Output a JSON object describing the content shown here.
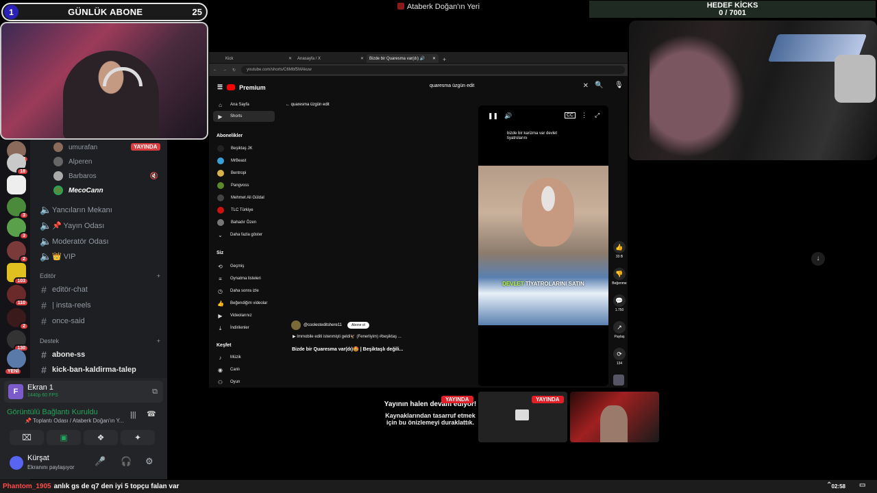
{
  "overlay": {
    "abone_num": "1",
    "abone_title": "GÜNLÜK ABONE",
    "abone_count": "25",
    "stream_title": "Ataberk Doğan'ın Yeri",
    "kicks_title": "HEDEF KİCKS",
    "kicks_value": "0 / 7001"
  },
  "discord": {
    "servers": [
      {
        "badge": "10"
      },
      {
        "badge": "18"
      },
      {
        "badge": ""
      },
      {
        "badge": "3"
      },
      {
        "badge": "3"
      },
      {
        "badge": "2"
      },
      {
        "badge": "103"
      },
      {
        "badge": "110"
      },
      {
        "badge": "2"
      },
      {
        "badge": "130"
      },
      {
        "badge": "YENİ"
      }
    ],
    "live_badge": "YAYINDA",
    "users": [
      "umurafan",
      "Alperen",
      "Barbaros",
      "MecoCann"
    ],
    "channels": [
      "Yancıların Mekanı",
      "📌 Yayın Odası",
      "Moderatör Odası",
      "👑 VIP"
    ],
    "cat_editor": "Editör",
    "editor_channels": [
      "editör-chat",
      "| insta-reels",
      "once-said"
    ],
    "cat_destek": "Destek",
    "destek_channels": [
      "abone-ss",
      "kick-ban-kaldirma-talep"
    ],
    "screen_title": "Ekran 1",
    "screen_sub": "1440p 60 FPS",
    "voice_status": "Görüntülü Bağlantı Kuruldu",
    "voice_channel": "📌 Toplantı Odası / Ataberk Doğan'ın Y...",
    "user_name": "Kürşat",
    "user_status": "Ekranını paylaşıyor"
  },
  "browser": {
    "tabs": [
      "Kick",
      "Anasayfa / X",
      "Bizde bir Quaresma var(dı) 🔊"
    ],
    "url": "youtube.com/shorts/C6Mbf5MAkuw",
    "logo": "Premium",
    "search_value": "quaresma üzgün edit",
    "nav": [
      {
        "label": "Ana Sayfa",
        "icon": "⌂"
      },
      {
        "label": "Shorts",
        "icon": "▶"
      }
    ],
    "subs_title": "Abonelikler",
    "subs": [
      {
        "label": "Beşiktaş JK",
        "color": "#222"
      },
      {
        "label": "MrBeast",
        "color": "#3aa0d8"
      },
      {
        "label": "Bentropi",
        "color": "#d8b34a"
      },
      {
        "label": "Pangvoss",
        "color": "#5a8a2a"
      },
      {
        "label": "Mehmet Ali Güldal",
        "color": "#444"
      },
      {
        "label": "TLC Türkiye",
        "color": "#c11"
      },
      {
        "label": "Bahadır Özen",
        "color": "#777"
      },
      {
        "label": "Daha fazla göster",
        "color": ""
      }
    ],
    "you_title": "Siz",
    "you": [
      "Geçmiş",
      "Oynatma listeleri",
      "Daha sonra izle",
      "Beğendiğim videolar",
      "Videolarınız",
      "İndirilenler"
    ],
    "explore_title": "Keşfet",
    "explore": [
      "Müzik",
      "Canlı",
      "Oyun"
    ],
    "back_label": "quaresma üzgün edit",
    "short_caption": "bizde bir karizma var devlet tiyatrolarını",
    "subtitle_green": "DEVLET",
    "subtitle_white": "TİYATROLARINI SATIN",
    "side": [
      {
        "icon": "👍",
        "label": "33 B"
      },
      {
        "icon": "👎",
        "label": "Beğenme"
      },
      {
        "icon": "💬",
        "label": "1.750"
      },
      {
        "icon": "↗",
        "label": "Paylaş"
      },
      {
        "icon": "⟳",
        "label": "134"
      }
    ],
    "channel": "@coolesteditshere11",
    "subscribe": "Abone ol",
    "music": "Immobile editi istenmişti geldi🦅 (Fenerliyim) #beşiktaş ...",
    "video_title": "Bizde bir Quaresma var(dı)🤩 | Beşiktaşlı değili..."
  },
  "bottom": {
    "still_title": "Yayının halen devam ediyor!",
    "still_sub": "Kaynaklarından tasarruf etmek için bu önizlemeyi duraklattık.",
    "live1": "YAYINDA",
    "live2": "YAYINDA"
  },
  "taskbar": {
    "user": "Phantom_1905",
    "message": "anlık gs de q7 den iyi 5 topçu falan var",
    "time": "02:58"
  }
}
